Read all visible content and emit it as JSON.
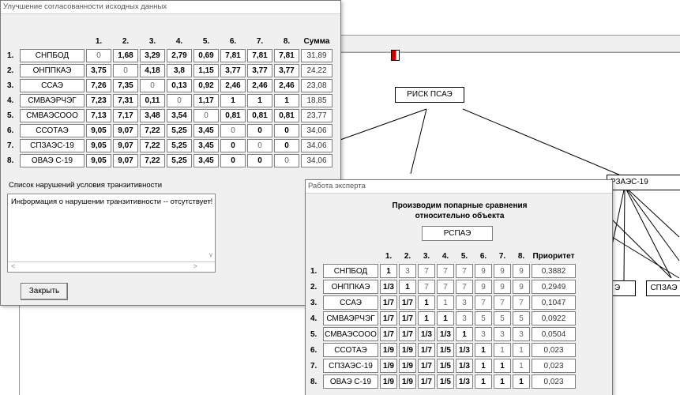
{
  "matrix_window": {
    "title": "Улучшение согласованности исходных данных",
    "column_headers": [
      "1.",
      "2.",
      "3.",
      "4.",
      "5.",
      "6.",
      "7.",
      "8."
    ],
    "sum_header": "Сумма",
    "rows": [
      {
        "num": "1.",
        "name": "СНПБОД",
        "values": [
          "0",
          "1,68",
          "3,29",
          "2,79",
          "0,69",
          "7,81",
          "7,81",
          "7,81"
        ],
        "sum": "31,89"
      },
      {
        "num": "2.",
        "name": "ОНППКАЭ",
        "values": [
          "3,75",
          "0",
          "4,18",
          "3,8",
          "1,15",
          "3,77",
          "3,77",
          "3,77"
        ],
        "sum": "24,22"
      },
      {
        "num": "3.",
        "name": "ССАЭ",
        "values": [
          "7,26",
          "7,35",
          "0",
          "0,13",
          "0,92",
          "2,46",
          "2,46",
          "2,46"
        ],
        "sum": "23,08"
      },
      {
        "num": "4.",
        "name": "СМВАЭРЧЭГ",
        "values": [
          "7,23",
          "7,31",
          "0,11",
          "0",
          "1,17",
          "1",
          "1",
          "1"
        ],
        "sum": "18,85"
      },
      {
        "num": "5.",
        "name": "СМВАЭСООО",
        "values": [
          "7,13",
          "7,17",
          "3,48",
          "3,54",
          "0",
          "0,81",
          "0,81",
          "0,81"
        ],
        "sum": "23,77"
      },
      {
        "num": "6.",
        "name": "ССОТАЭ",
        "values": [
          "9,05",
          "9,07",
          "7,22",
          "5,25",
          "3,45",
          "0",
          "0",
          "0"
        ],
        "sum": "34,06"
      },
      {
        "num": "7.",
        "name": "СПЗАЭС-19",
        "values": [
          "9,05",
          "9,07",
          "7,22",
          "5,25",
          "3,45",
          "0",
          "0",
          "0"
        ],
        "sum": "34,06"
      },
      {
        "num": "8.",
        "name": "ОВАЭ С-19",
        "values": [
          "9,05",
          "9,07",
          "7,22",
          "5,25",
          "3,45",
          "0",
          "0",
          "0"
        ],
        "sum": "34,06"
      }
    ],
    "violations_label": "Список нарушений условия транзитивности",
    "violations_text": "Информация о нарушении транзитивности -- отсутствует!",
    "scroll_up": "^",
    "scroll_down": "v",
    "scroll_left": "<",
    "scroll_right": ">",
    "close_label": "Закрыть"
  },
  "tree": {
    "root": "РИСК ПСАЭ",
    "node_right": "РЗАЭС-19",
    "node_bottom_right": "СПЗАЭ",
    "node_bottom_partial": "Э"
  },
  "expert_window": {
    "title": "Работа эксперта",
    "heading_line1": "Производим попарные сравнения",
    "heading_line2": "относительно объекта",
    "object": "РСПАЭ",
    "column_headers": [
      "1.",
      "2.",
      "3.",
      "4.",
      "5.",
      "6.",
      "7.",
      "8."
    ],
    "priority_header": "Приоритет",
    "rows": [
      {
        "num": "1.",
        "name": "СНПБОД",
        "values": [
          "1",
          "3",
          "7",
          "7",
          "7",
          "9",
          "9",
          "9"
        ],
        "priority": "0,3882"
      },
      {
        "num": "2.",
        "name": "ОНППКАЭ",
        "values": [
          "1/3",
          "1",
          "7",
          "7",
          "7",
          "9",
          "9",
          "9"
        ],
        "priority": "0,2949"
      },
      {
        "num": "3.",
        "name": "ССАЭ",
        "values": [
          "1/7",
          "1/7",
          "1",
          "1",
          "3",
          "7",
          "7",
          "7"
        ],
        "priority": "0,1047"
      },
      {
        "num": "4.",
        "name": "СМВАЭРЧЭГ",
        "values": [
          "1/7",
          "1/7",
          "1",
          "1",
          "3",
          "5",
          "5",
          "5"
        ],
        "priority": "0,0922"
      },
      {
        "num": "5.",
        "name": "СМВАЭСООО",
        "values": [
          "1/7",
          "1/7",
          "1/3",
          "1/3",
          "1",
          "3",
          "3",
          "3"
        ],
        "priority": "0,0504"
      },
      {
        "num": "6.",
        "name": "ССОТАЭ",
        "values": [
          "1/9",
          "1/9",
          "1/7",
          "1/5",
          "1/3",
          "1",
          "1",
          "1"
        ],
        "priority": "0,023"
      },
      {
        "num": "7.",
        "name": "СПЗАЭС-19",
        "values": [
          "1/9",
          "1/9",
          "1/7",
          "1/5",
          "1/3",
          "1",
          "1",
          "1"
        ],
        "priority": "0,023"
      },
      {
        "num": "8.",
        "name": "ОВАЭ С-19",
        "values": [
          "1/9",
          "1/9",
          "1/7",
          "1/5",
          "1/3",
          "1",
          "1",
          "1"
        ],
        "priority": "0,023"
      }
    ]
  },
  "icons": {
    "exit": "exit-door-icon"
  }
}
